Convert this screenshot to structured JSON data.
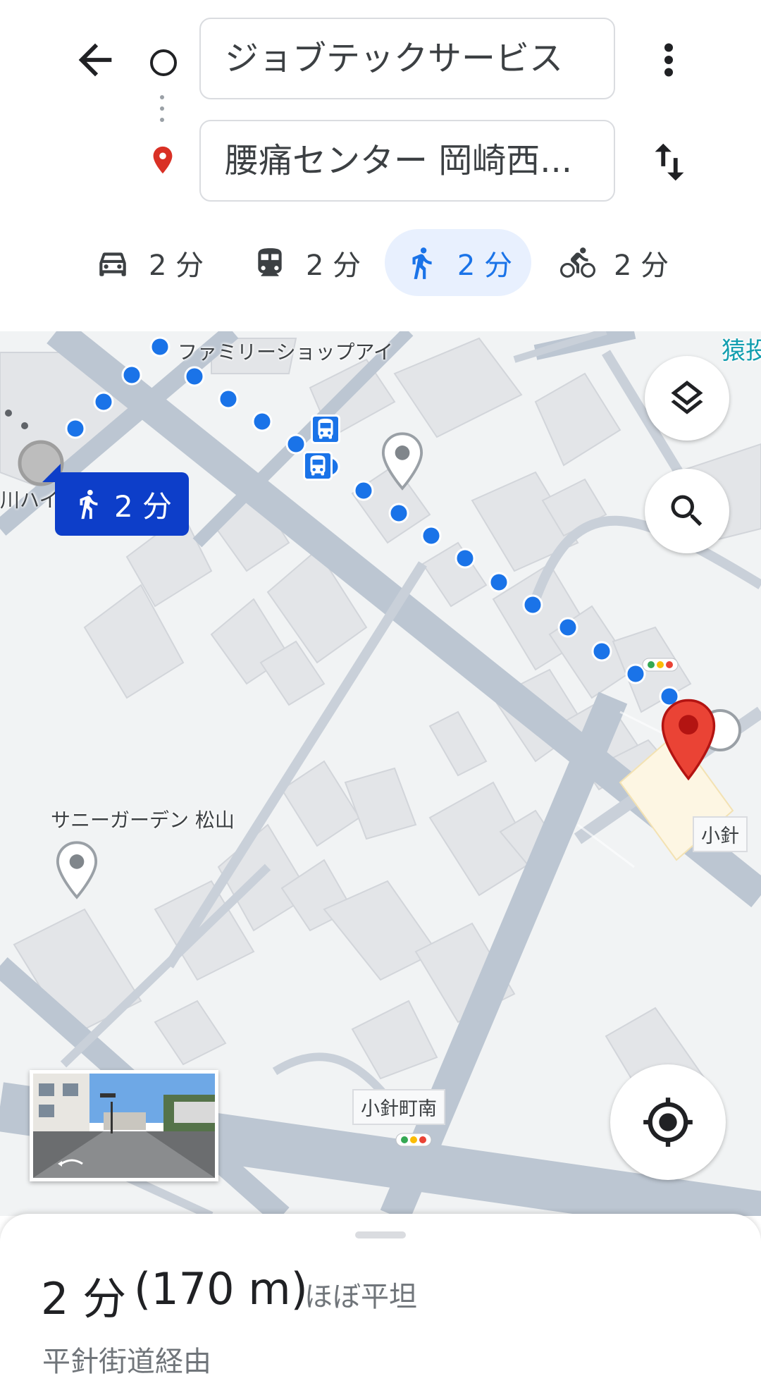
{
  "header": {
    "origin": "ジョブテックサービス",
    "destination": "腰痛センター 岡崎西...",
    "back_icon": "arrow-back-icon",
    "more_icon": "more-vert-icon",
    "swap_icon": "swap-vert-icon"
  },
  "modes": [
    {
      "name": "car",
      "icon": "car-icon",
      "label": "2 分",
      "selected": false
    },
    {
      "name": "transit",
      "icon": "train-icon",
      "label": "2 分",
      "selected": false
    },
    {
      "name": "walk",
      "icon": "walk-icon",
      "label": "2 分",
      "selected": true
    },
    {
      "name": "bike",
      "icon": "bike-icon",
      "label": "2 分",
      "selected": false
    }
  ],
  "map": {
    "labels": {
      "family_shop": "ファミリーショップアイ",
      "sunny_garden": "サニーガーデン 松山",
      "left_edge": "川ハイ",
      "right_edge": "猿投",
      "kobari": "小針",
      "kobari_minami": "小針町南"
    },
    "route_badge": "2 分",
    "accent": "#1a73e8",
    "badge_color": "#0d3ec9",
    "pin_color": "#ea4335"
  },
  "summary": {
    "time": "2 分",
    "distance": "(170 m)",
    "terrain": "ほぼ平坦",
    "via": "平針街道経由"
  }
}
